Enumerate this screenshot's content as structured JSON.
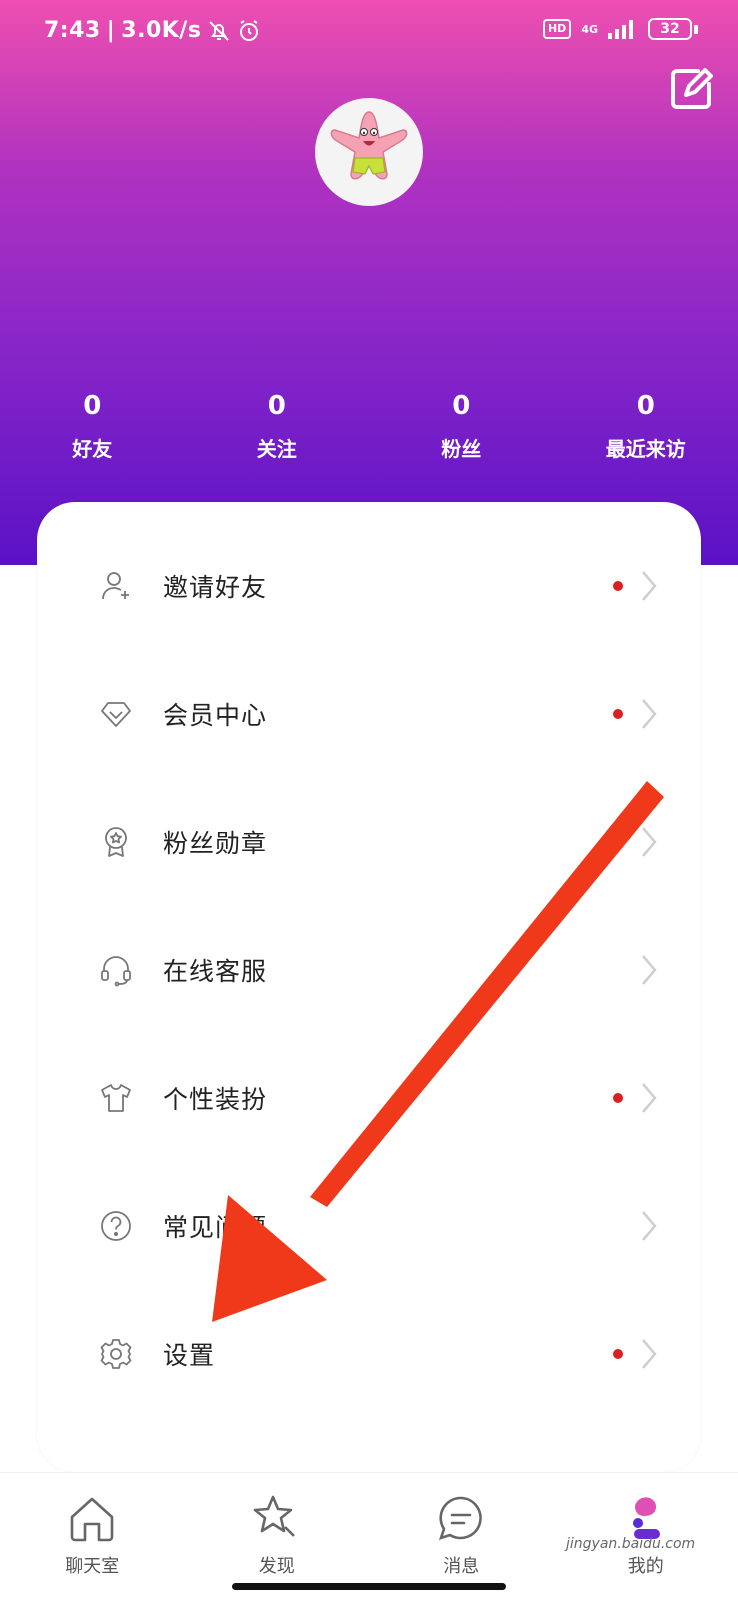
{
  "status_bar": {
    "time": "7:43",
    "speed": "3.0K/s",
    "hd": "HD",
    "network": "4G",
    "battery": "32"
  },
  "profile": {
    "stats": [
      {
        "value": "0",
        "label": "好友"
      },
      {
        "value": "0",
        "label": "关注"
      },
      {
        "value": "0",
        "label": "粉丝"
      },
      {
        "value": "0",
        "label": "最近来访"
      }
    ]
  },
  "menu": {
    "items": [
      {
        "label": "邀请好友",
        "icon": "add-user-icon",
        "dot": true
      },
      {
        "label": "会员中心",
        "icon": "diamond-icon",
        "dot": true
      },
      {
        "label": "粉丝勋章",
        "icon": "medal-icon",
        "dot": false
      },
      {
        "label": "在线客服",
        "icon": "headset-icon",
        "dot": false
      },
      {
        "label": "个性装扮",
        "icon": "tshirt-icon",
        "dot": true
      },
      {
        "label": "常见问题",
        "icon": "question-icon",
        "dot": false
      },
      {
        "label": "设置",
        "icon": "gear-icon",
        "dot": true
      }
    ]
  },
  "tabbar": {
    "tabs": [
      {
        "label": "聊天室",
        "icon": "home-icon"
      },
      {
        "label": "发现",
        "icon": "star-search-icon"
      },
      {
        "label": "消息",
        "icon": "message-icon"
      },
      {
        "label": "我的",
        "icon": "profile-icon",
        "active": true
      }
    ]
  },
  "colors": {
    "gradient_top": "#ee4fb0",
    "gradient_bottom": "#5a12c6",
    "dot": "#d91f1f",
    "annotation_arrow": "#f0391a"
  },
  "watermark": "jingyan.baidu.com"
}
